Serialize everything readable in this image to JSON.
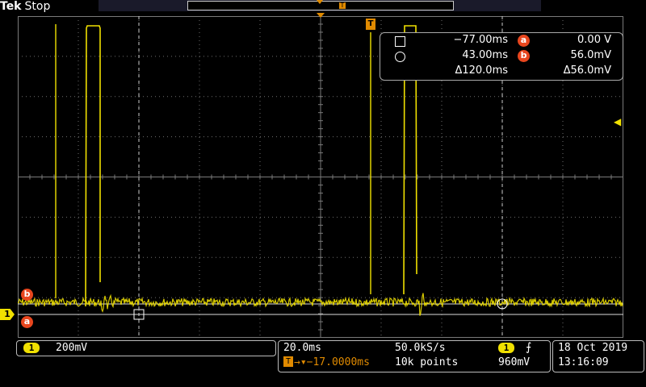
{
  "brand": {
    "name": "Tek",
    "state": "Stop"
  },
  "channel_markers": {
    "ch1": "1",
    "a": "a",
    "b": "b",
    "trigger_T": "T"
  },
  "cursor_readout": {
    "cursor1_time": "−77.00ms",
    "cursor2_time": "43.00ms",
    "delta_time": "Δ120.0ms",
    "a_label": "a",
    "b_label": "b",
    "a_value": "0.00 V",
    "b_value": "56.0mV",
    "delta_value": "Δ56.0mV"
  },
  "channel_panel": {
    "badge": "1",
    "scale": "200mV"
  },
  "horizontal": {
    "time_div": "20.0ms",
    "sample_rate": "50.0kS/s",
    "trigger_delay": "→▾−17.0000ms",
    "record_length": "10k points"
  },
  "trigger": {
    "source": "1",
    "slope_icon": "rising-edge",
    "level": "960mV"
  },
  "datetime": {
    "date": "18 Oct  2019",
    "time": "13:16:09"
  },
  "colors": {
    "ch1": "#f0e000",
    "trigger": "#e08a00",
    "cursor_badge": "#e8461e",
    "grid": "#7a7a7a"
  }
}
